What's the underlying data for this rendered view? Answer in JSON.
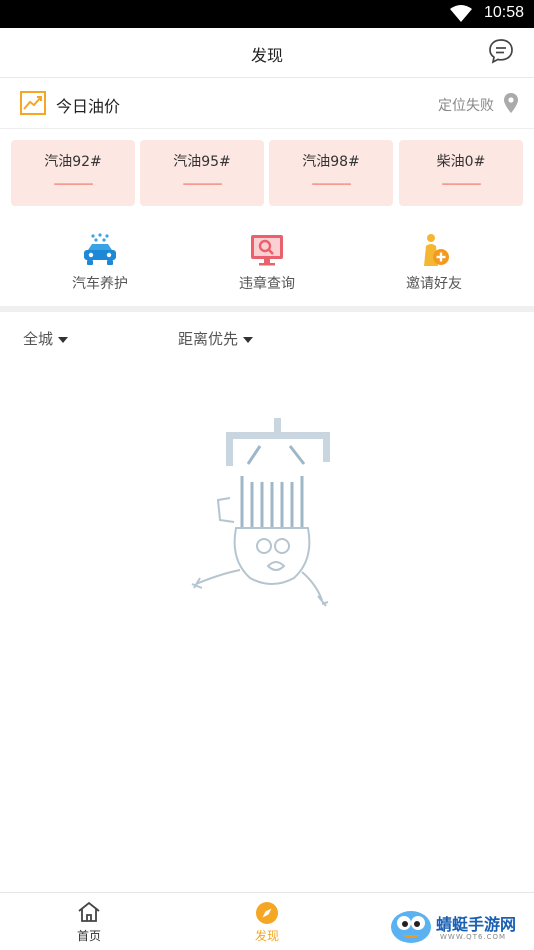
{
  "status_bar": {
    "time": "10:58"
  },
  "header": {
    "title": "发现"
  },
  "oil": {
    "title": "今日油价",
    "location_status": "定位失败",
    "cards": [
      {
        "name": "汽油92#",
        "price": "-------------"
      },
      {
        "name": "汽油95#",
        "price": "-------------"
      },
      {
        "name": "汽油98#",
        "price": "-------------"
      },
      {
        "name": "柴油0#",
        "price": "-------------"
      }
    ]
  },
  "services": [
    {
      "label": "汽车养护",
      "icon": "car-wash-icon"
    },
    {
      "label": "违章查询",
      "icon": "violation-search-icon"
    },
    {
      "label": "邀请好友",
      "icon": "invite-friend-icon"
    }
  ],
  "filters": {
    "area": "全城",
    "sort": "距离优先"
  },
  "tabs": [
    {
      "label": "首页",
      "icon": "home-icon",
      "active": false
    },
    {
      "label": "发现",
      "icon": "compass-icon",
      "active": true
    }
  ],
  "watermark": {
    "brand": "蜻蜓手游网",
    "url": "WWW.QT6.COM"
  },
  "colors": {
    "accent": "#f5a623",
    "card_bg": "#fde7e3",
    "price": "#e64a3b"
  }
}
